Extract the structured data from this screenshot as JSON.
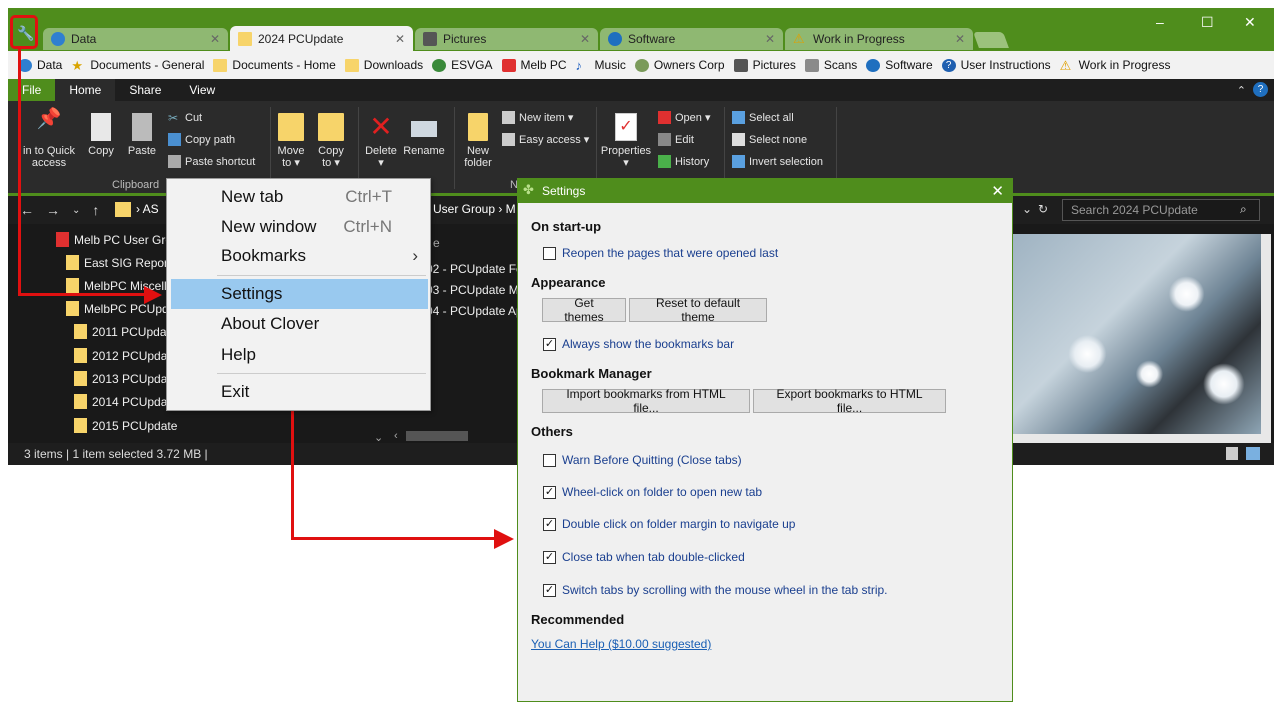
{
  "tabs": [
    {
      "label": "Data"
    },
    {
      "label": "2024 PCUpdate"
    },
    {
      "label": "Pictures"
    },
    {
      "label": "Software"
    },
    {
      "label": "Work in Progress"
    }
  ],
  "window_controls": {
    "minimize": "–",
    "maximize": "☐",
    "close": "✕"
  },
  "bookmarks": [
    "Data",
    "Documents - General",
    "Documents - Home",
    "Downloads",
    "ESVGA",
    "Melb PC",
    "Music",
    "Owners Corp",
    "Pictures",
    "Scans",
    "Software",
    "User Instructions",
    "Work in Progress"
  ],
  "ribbon_tabs": [
    "File",
    "Home",
    "Share",
    "View"
  ],
  "ribbon": {
    "pin_label": "in to Quick access",
    "copy": "Copy",
    "paste": "Paste",
    "cut": "Cut",
    "copy_path": "Copy path",
    "paste_shortcut": "Paste shortcut",
    "clipboard_group": "Clipboard",
    "move_to": "Move to ▾",
    "copy_to": "Copy to ▾",
    "delete": "Delete ▾",
    "rename": "Rename",
    "new_folder": "New folder",
    "new_item": "New item ▾",
    "easy_access": "Easy access ▾",
    "new_group": "N",
    "properties": "Properties ▾",
    "open": "Open ▾",
    "edit": "Edit",
    "history": "History",
    "select_all": "Select all",
    "select_none": "Select none",
    "invert_selection": "Invert selection"
  },
  "address": {
    "crumb_left": "AS",
    "crumb_mid": "User Group  ›  M",
    "search_placeholder": "Search 2024 PCUpdate"
  },
  "tree": [
    "Melb PC User Gro",
    "East SIG Reports",
    "MelbPC Miscell",
    "MelbPC PCUpd",
    "2011 PCUpdat",
    "2012 PCUpdat",
    "2013 PCUpdat",
    "2014 PCUpdat",
    "2015 PCUpdate"
  ],
  "files": {
    "header": "e",
    "rows": [
      "02 - PCUpdate Fe",
      "03 - PCUpdate Ma",
      "04 - PCUpdate Ap"
    ]
  },
  "status": "3 items  |  1 item selected  3.72 MB  |",
  "menu": {
    "items": [
      {
        "label": "New tab",
        "shortcut": "Ctrl+T"
      },
      {
        "label": "New window",
        "shortcut": "Ctrl+N"
      },
      {
        "label": "Bookmarks",
        "shortcut": "›"
      },
      {
        "label": "Settings",
        "shortcut": ""
      },
      {
        "label": "About Clover",
        "shortcut": ""
      },
      {
        "label": "Help",
        "shortcut": ""
      },
      {
        "label": "Exit",
        "shortcut": ""
      }
    ]
  },
  "settings": {
    "title": "Settings",
    "startup_heading": "On start-up",
    "reopen": "Reopen the pages that were opened last",
    "appearance_heading": "Appearance",
    "get_themes": "Get themes",
    "reset_theme": "Reset to default theme",
    "show_bookmarks": "Always show the bookmarks bar",
    "bookmark_heading": "Bookmark Manager",
    "import_btn": "Import bookmarks from HTML file...",
    "export_btn": "Export bookmarks to HTML file...",
    "others_heading": "Others",
    "warn_quit": "Warn Before Quitting (Close tabs)",
    "wheel_click": "Wheel-click on folder to open new tab",
    "double_click": "Double click on folder margin to navigate up",
    "close_tab": "Close tab when tab double-clicked",
    "switch_tabs": "Switch tabs by scrolling with the mouse wheel in the tab strip.",
    "recommended_heading": "Recommended",
    "help_link": "You Can Help ($10.00 suggested)",
    "checks": {
      "reopen": false,
      "show_bookmarks": true,
      "warn_quit": false,
      "wheel_click": true,
      "double_click": true,
      "close_tab": true,
      "switch_tabs": true
    },
    "check_mark": "✓"
  },
  "colors": {
    "accent": "#4f8d1c",
    "annotation": "#e01010",
    "highlight": "#99c9ef"
  }
}
